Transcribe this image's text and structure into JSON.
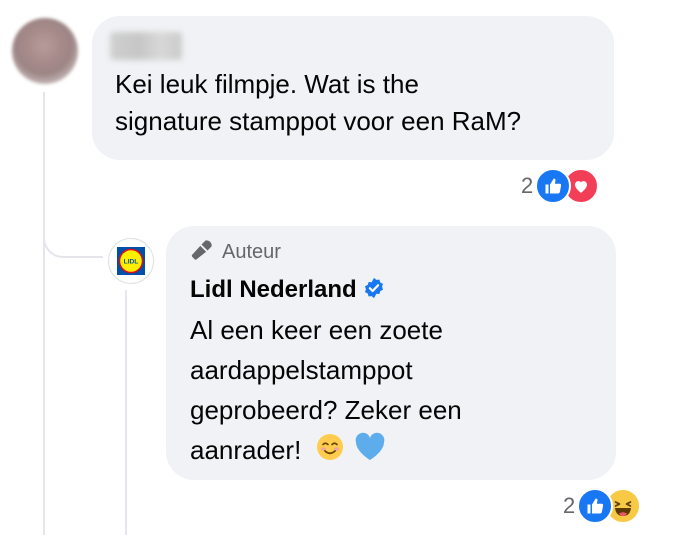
{
  "comment": {
    "author_name": "",
    "text_lines": [
      "Kei leuk filmpje. Wat is the",
      "signature stamppot voor een RaM?"
    ],
    "reactions": {
      "count": "2",
      "types": [
        "like-icon",
        "love-icon"
      ]
    }
  },
  "reply": {
    "badge_label": "Auteur",
    "author_name": "Lidl Nederland",
    "verified": true,
    "text_lines": [
      "Al een keer een zoete",
      "aardappelstamppot",
      "geprobeerd? Zeker een",
      "aanrader!"
    ],
    "emojis": [
      "smiling-face-icon",
      "blue-heart-icon"
    ],
    "reactions": {
      "count": "2",
      "types": [
        "like-icon",
        "haha-icon"
      ]
    }
  },
  "colors": {
    "bubble": "#f0f2f5",
    "like": "#1877f2",
    "love": "#f33e58",
    "verified": "#1877f2",
    "lidl_blue": "#0050aa",
    "lidl_yellow": "#fff000",
    "lidl_red": "#e60a14"
  }
}
